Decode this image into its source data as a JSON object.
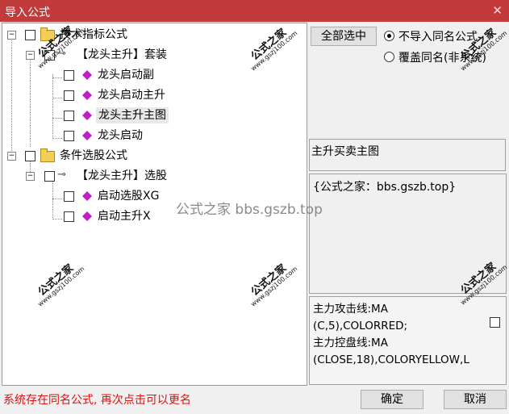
{
  "window": {
    "title": "导入公式",
    "close_glyph": "✕"
  },
  "tree": {
    "groups": [
      {
        "label": "技术指标公式",
        "set_label": "【龙头主升】套装",
        "items": [
          "龙头启动副",
          "龙头启动主升",
          "龙头主升主图",
          "龙头启动"
        ]
      },
      {
        "label": "条件选股公式",
        "set_label": "【龙头主升】选股",
        "items": [
          "启动选股XG",
          "启动主升X"
        ]
      }
    ],
    "selected_item": "龙头主升主图"
  },
  "controls": {
    "select_all": "全部选中",
    "radio_no_import": "不导入同名公式",
    "radio_overwrite": "覆盖同名(非系统)",
    "selected_radio": "不导入同名公式"
  },
  "detail": {
    "formula_name": "主升买卖主图",
    "description": "{公式之家：bbs.gszb.top}",
    "code": "主力攻击线:MA\n(C,5),COLORRED;\n主力控盘线:MA\n(CLOSE,18),COLORYELLOW,L"
  },
  "watermarks": {
    "overlay": "公式之家 bbs.gszb.top",
    "stamp_title": "公式之家",
    "stamp_url": "www.gszj100.com"
  },
  "footer": {
    "status": "系统存在同名公式, 再次点击可以更名",
    "ok": "确定",
    "cancel": "取消"
  },
  "colors": {
    "title_bar": "#c23a3a",
    "status_text": "#e01010",
    "gem": "#c01ec8"
  },
  "icons": [
    "folder-icon",
    "key-icon",
    "gem-icon",
    "close-icon",
    "checkbox-icon",
    "radio-icon"
  ]
}
